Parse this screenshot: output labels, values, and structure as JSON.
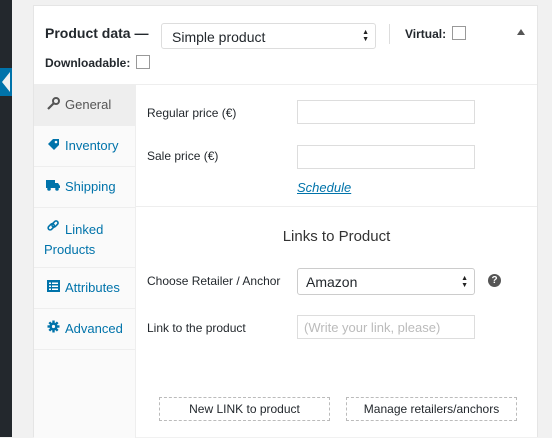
{
  "header": {
    "title": "Product data —",
    "product_type": "Simple product",
    "virtual_label": "Virtual:",
    "downloadable_label": "Downloadable:"
  },
  "tabs": [
    {
      "label": "General",
      "icon": "wrench-icon"
    },
    {
      "label": "Inventory",
      "icon": "tag-icon"
    },
    {
      "label": "Shipping",
      "icon": "truck-icon"
    },
    {
      "label": "Linked Products",
      "icon": "link-icon"
    },
    {
      "label": "Attributes",
      "icon": "list-icon"
    },
    {
      "label": "Advanced",
      "icon": "gear-icon"
    }
  ],
  "general": {
    "regular_price_label": "Regular price (€)",
    "sale_price_label": "Sale price (€)",
    "schedule_link": "Schedule",
    "regular_price_value": "",
    "sale_price_value": ""
  },
  "links_section": {
    "title": "Links to Product",
    "retailer_label": "Choose Retailer / Anchor",
    "retailer_value": "Amazon",
    "help_glyph": "?",
    "link_label": "Link to the product",
    "link_placeholder": "(Write your link, please)"
  },
  "buttons": {
    "new_link": "New LINK to product",
    "manage": "Manage retailers/anchors"
  }
}
